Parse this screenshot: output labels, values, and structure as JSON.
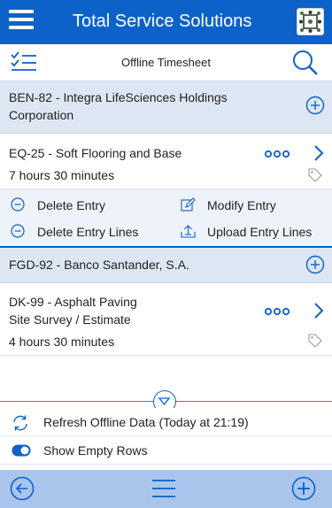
{
  "header": {
    "title": "Total Service Solutions",
    "menu_icon": "hamburger-icon",
    "logo_icon": "app-logo"
  },
  "toolbar": {
    "title": "Offline Timesheet",
    "list_icon": "checklist-icon",
    "search_icon": "search-icon"
  },
  "groups": [
    {
      "title_line1": "BEN-82 - Integra LifeSciences Holdings",
      "title_line2": "Corporation",
      "entries": [
        {
          "title": "EQ-25 - Soft Flooring and Base",
          "duration": "7 hours 30 minutes"
        }
      ],
      "actions": {
        "delete_entry": "Delete Entry",
        "modify_entry": "Modify Entry",
        "delete_entry_lines": "Delete Entry Lines",
        "upload_entry_lines": "Upload Entry Lines"
      }
    },
    {
      "title_line1": "FGD-92 - Banco Santander, S.A.",
      "entries": [
        {
          "title_line1": "DK-99 - Asphalt Paving",
          "title_line2": "Site Survey / Estimate",
          "duration": "4 hours 30 minutes"
        }
      ]
    }
  ],
  "footer": {
    "refresh_label": "Refresh Offline Data (Today at 21:19)",
    "show_empty_label": "Show Empty Rows",
    "show_empty_enabled": true
  },
  "colors": {
    "primary": "#0d62c9",
    "group_bg": "#dde7f4",
    "bottom_bar": "#a9c5ec"
  }
}
